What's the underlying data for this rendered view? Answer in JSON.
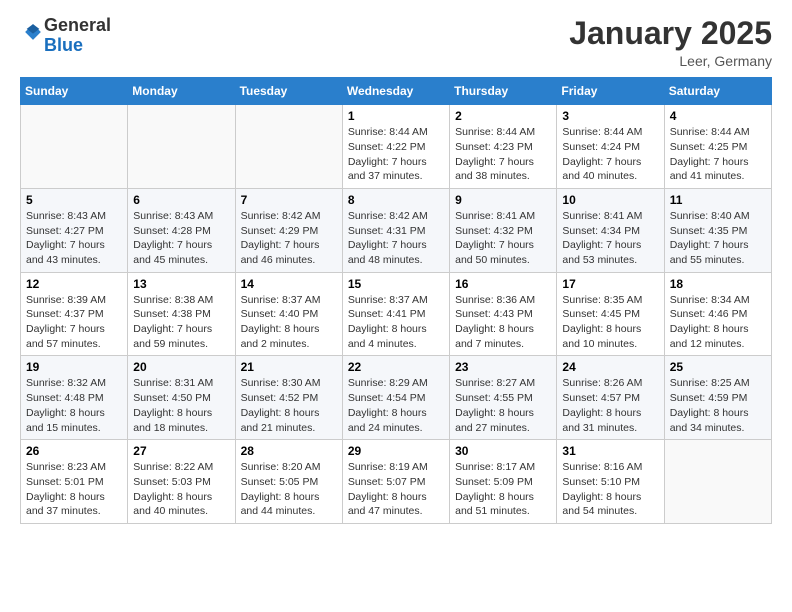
{
  "header": {
    "logo_general": "General",
    "logo_blue": "Blue",
    "month_title": "January 2025",
    "location": "Leer, Germany"
  },
  "weekdays": [
    "Sunday",
    "Monday",
    "Tuesday",
    "Wednesday",
    "Thursday",
    "Friday",
    "Saturday"
  ],
  "weeks": [
    [
      {
        "day": "",
        "sunrise": "",
        "sunset": "",
        "daylight": ""
      },
      {
        "day": "",
        "sunrise": "",
        "sunset": "",
        "daylight": ""
      },
      {
        "day": "",
        "sunrise": "",
        "sunset": "",
        "daylight": ""
      },
      {
        "day": "1",
        "sunrise": "Sunrise: 8:44 AM",
        "sunset": "Sunset: 4:22 PM",
        "daylight": "Daylight: 7 hours and 37 minutes."
      },
      {
        "day": "2",
        "sunrise": "Sunrise: 8:44 AM",
        "sunset": "Sunset: 4:23 PM",
        "daylight": "Daylight: 7 hours and 38 minutes."
      },
      {
        "day": "3",
        "sunrise": "Sunrise: 8:44 AM",
        "sunset": "Sunset: 4:24 PM",
        "daylight": "Daylight: 7 hours and 40 minutes."
      },
      {
        "day": "4",
        "sunrise": "Sunrise: 8:44 AM",
        "sunset": "Sunset: 4:25 PM",
        "daylight": "Daylight: 7 hours and 41 minutes."
      }
    ],
    [
      {
        "day": "5",
        "sunrise": "Sunrise: 8:43 AM",
        "sunset": "Sunset: 4:27 PM",
        "daylight": "Daylight: 7 hours and 43 minutes."
      },
      {
        "day": "6",
        "sunrise": "Sunrise: 8:43 AM",
        "sunset": "Sunset: 4:28 PM",
        "daylight": "Daylight: 7 hours and 45 minutes."
      },
      {
        "day": "7",
        "sunrise": "Sunrise: 8:42 AM",
        "sunset": "Sunset: 4:29 PM",
        "daylight": "Daylight: 7 hours and 46 minutes."
      },
      {
        "day": "8",
        "sunrise": "Sunrise: 8:42 AM",
        "sunset": "Sunset: 4:31 PM",
        "daylight": "Daylight: 7 hours and 48 minutes."
      },
      {
        "day": "9",
        "sunrise": "Sunrise: 8:41 AM",
        "sunset": "Sunset: 4:32 PM",
        "daylight": "Daylight: 7 hours and 50 minutes."
      },
      {
        "day": "10",
        "sunrise": "Sunrise: 8:41 AM",
        "sunset": "Sunset: 4:34 PM",
        "daylight": "Daylight: 7 hours and 53 minutes."
      },
      {
        "day": "11",
        "sunrise": "Sunrise: 8:40 AM",
        "sunset": "Sunset: 4:35 PM",
        "daylight": "Daylight: 7 hours and 55 minutes."
      }
    ],
    [
      {
        "day": "12",
        "sunrise": "Sunrise: 8:39 AM",
        "sunset": "Sunset: 4:37 PM",
        "daylight": "Daylight: 7 hours and 57 minutes."
      },
      {
        "day": "13",
        "sunrise": "Sunrise: 8:38 AM",
        "sunset": "Sunset: 4:38 PM",
        "daylight": "Daylight: 7 hours and 59 minutes."
      },
      {
        "day": "14",
        "sunrise": "Sunrise: 8:37 AM",
        "sunset": "Sunset: 4:40 PM",
        "daylight": "Daylight: 8 hours and 2 minutes."
      },
      {
        "day": "15",
        "sunrise": "Sunrise: 8:37 AM",
        "sunset": "Sunset: 4:41 PM",
        "daylight": "Daylight: 8 hours and 4 minutes."
      },
      {
        "day": "16",
        "sunrise": "Sunrise: 8:36 AM",
        "sunset": "Sunset: 4:43 PM",
        "daylight": "Daylight: 8 hours and 7 minutes."
      },
      {
        "day": "17",
        "sunrise": "Sunrise: 8:35 AM",
        "sunset": "Sunset: 4:45 PM",
        "daylight": "Daylight: 8 hours and 10 minutes."
      },
      {
        "day": "18",
        "sunrise": "Sunrise: 8:34 AM",
        "sunset": "Sunset: 4:46 PM",
        "daylight": "Daylight: 8 hours and 12 minutes."
      }
    ],
    [
      {
        "day": "19",
        "sunrise": "Sunrise: 8:32 AM",
        "sunset": "Sunset: 4:48 PM",
        "daylight": "Daylight: 8 hours and 15 minutes."
      },
      {
        "day": "20",
        "sunrise": "Sunrise: 8:31 AM",
        "sunset": "Sunset: 4:50 PM",
        "daylight": "Daylight: 8 hours and 18 minutes."
      },
      {
        "day": "21",
        "sunrise": "Sunrise: 8:30 AM",
        "sunset": "Sunset: 4:52 PM",
        "daylight": "Daylight: 8 hours and 21 minutes."
      },
      {
        "day": "22",
        "sunrise": "Sunrise: 8:29 AM",
        "sunset": "Sunset: 4:54 PM",
        "daylight": "Daylight: 8 hours and 24 minutes."
      },
      {
        "day": "23",
        "sunrise": "Sunrise: 8:27 AM",
        "sunset": "Sunset: 4:55 PM",
        "daylight": "Daylight: 8 hours and 27 minutes."
      },
      {
        "day": "24",
        "sunrise": "Sunrise: 8:26 AM",
        "sunset": "Sunset: 4:57 PM",
        "daylight": "Daylight: 8 hours and 31 minutes."
      },
      {
        "day": "25",
        "sunrise": "Sunrise: 8:25 AM",
        "sunset": "Sunset: 4:59 PM",
        "daylight": "Daylight: 8 hours and 34 minutes."
      }
    ],
    [
      {
        "day": "26",
        "sunrise": "Sunrise: 8:23 AM",
        "sunset": "Sunset: 5:01 PM",
        "daylight": "Daylight: 8 hours and 37 minutes."
      },
      {
        "day": "27",
        "sunrise": "Sunrise: 8:22 AM",
        "sunset": "Sunset: 5:03 PM",
        "daylight": "Daylight: 8 hours and 40 minutes."
      },
      {
        "day": "28",
        "sunrise": "Sunrise: 8:20 AM",
        "sunset": "Sunset: 5:05 PM",
        "daylight": "Daylight: 8 hours and 44 minutes."
      },
      {
        "day": "29",
        "sunrise": "Sunrise: 8:19 AM",
        "sunset": "Sunset: 5:07 PM",
        "daylight": "Daylight: 8 hours and 47 minutes."
      },
      {
        "day": "30",
        "sunrise": "Sunrise: 8:17 AM",
        "sunset": "Sunset: 5:09 PM",
        "daylight": "Daylight: 8 hours and 51 minutes."
      },
      {
        "day": "31",
        "sunrise": "Sunrise: 8:16 AM",
        "sunset": "Sunset: 5:10 PM",
        "daylight": "Daylight: 8 hours and 54 minutes."
      },
      {
        "day": "",
        "sunrise": "",
        "sunset": "",
        "daylight": ""
      }
    ]
  ]
}
